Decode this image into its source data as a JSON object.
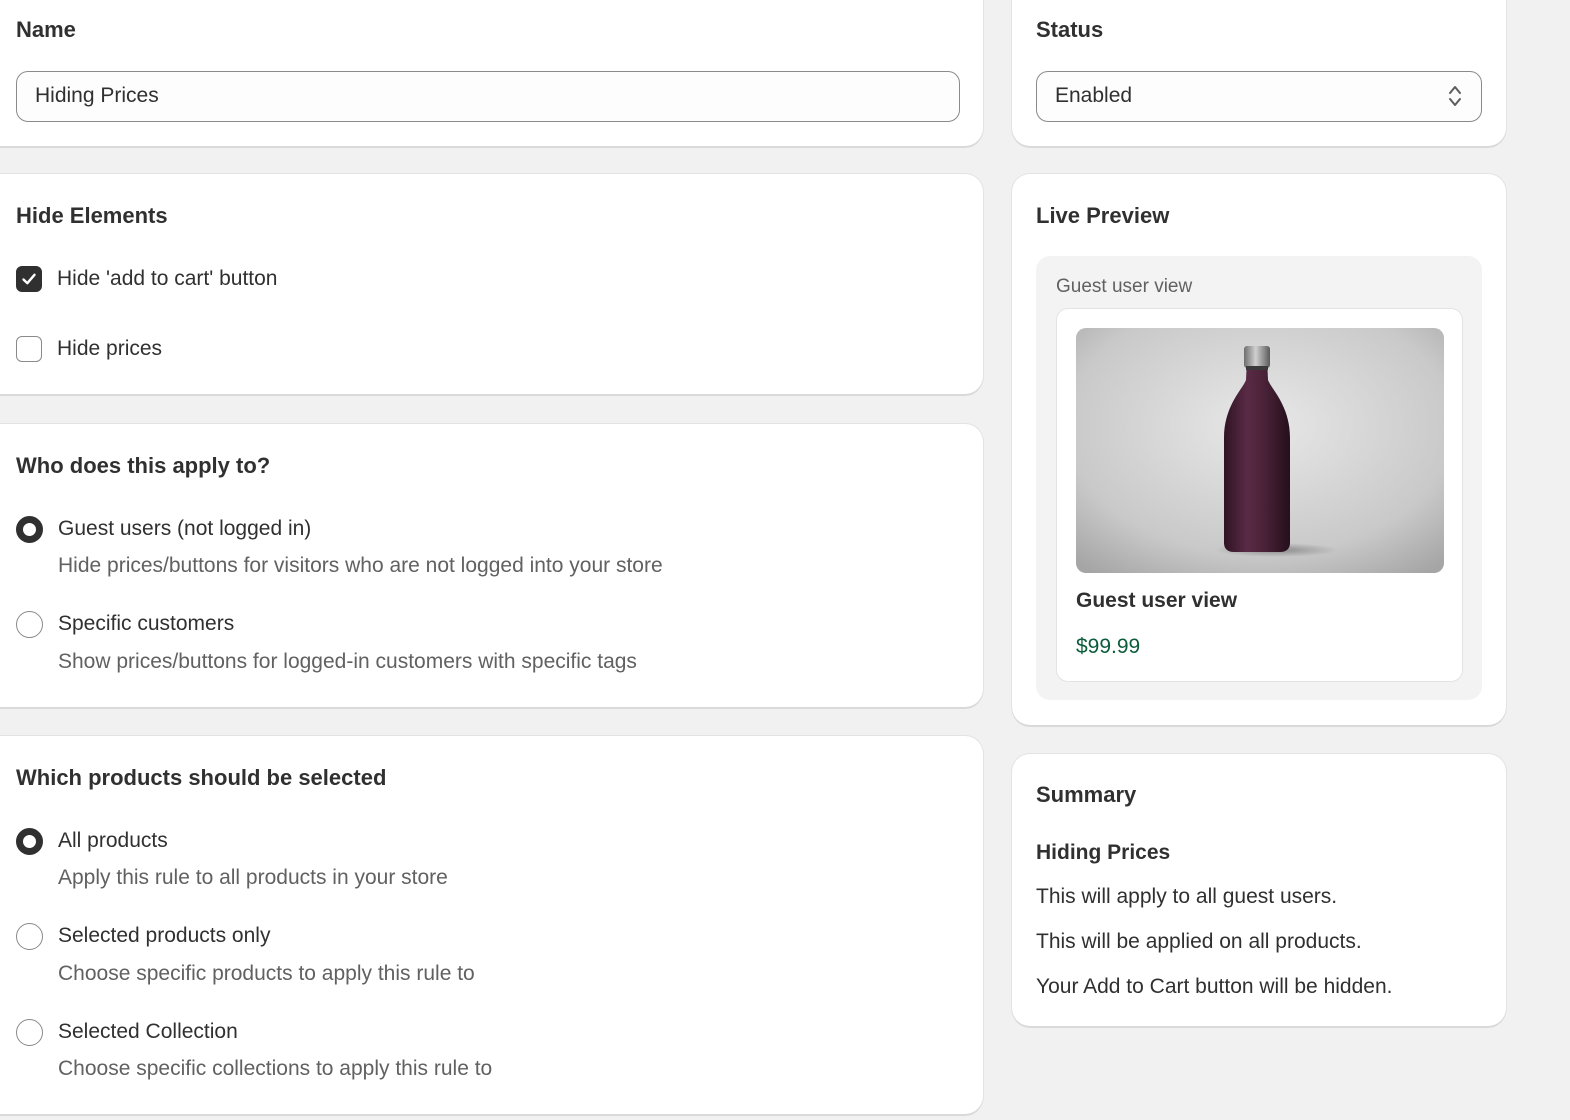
{
  "name_card": {
    "title": "Name",
    "value": "Hiding Prices"
  },
  "status_card": {
    "title": "Status",
    "selected": "Enabled"
  },
  "hide_elements": {
    "title": "Hide Elements",
    "options": [
      {
        "label": "Hide 'add to cart' button",
        "checked": true
      },
      {
        "label": "Hide prices",
        "checked": false
      }
    ]
  },
  "apply_to": {
    "title": "Who does this apply to?",
    "options": [
      {
        "label": "Guest users (not logged in)",
        "help": "Hide prices/buttons for visitors who are not logged into your store",
        "selected": true
      },
      {
        "label": "Specific customers",
        "help": "Show prices/buttons for logged-in customers with specific tags",
        "selected": false
      }
    ]
  },
  "products": {
    "title": "Which products should be selected",
    "options": [
      {
        "label": "All products",
        "help": "Apply this rule to all products in your store",
        "selected": true
      },
      {
        "label": "Selected products only",
        "help": "Choose specific products to apply this rule to",
        "selected": false
      },
      {
        "label": "Selected Collection",
        "help": "Choose specific collections to apply this rule to",
        "selected": false
      }
    ]
  },
  "live_preview": {
    "title": "Live Preview",
    "view_label": "Guest user view",
    "product_title": "Guest user view",
    "product_price": "$99.99"
  },
  "summary": {
    "title": "Summary",
    "rule_name": "Hiding Prices",
    "lines": [
      "This will apply to all guest users.",
      "This will be applied on all products.",
      "Your Add to Cart button will be hidden."
    ]
  },
  "colors": {
    "page_bg": "#f1f1f1",
    "card_bg": "#ffffff",
    "text": "#303030",
    "subdued": "#616161",
    "price": "#0b5c3b",
    "bottle": "#4a2338"
  }
}
